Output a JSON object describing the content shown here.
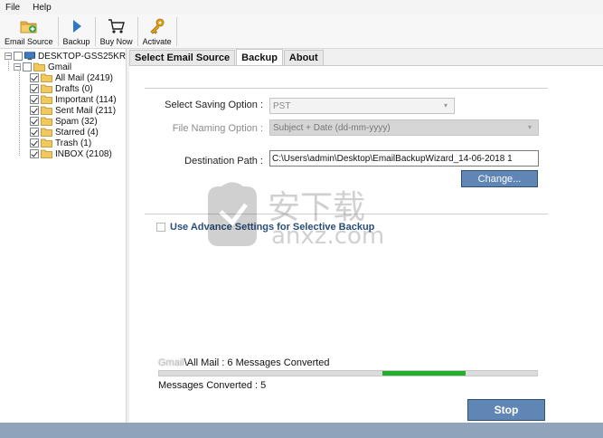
{
  "menu": {
    "items": [
      "File",
      "Help"
    ]
  },
  "toolbar": {
    "email_source": "Email Source",
    "backup": "Backup",
    "buy_now": "Buy Now",
    "activate": "Activate"
  },
  "tree": {
    "root": "DESKTOP-GSS25KR",
    "account": "Gmail",
    "folders": [
      {
        "label": "All Mail (2419)"
      },
      {
        "label": "Drafts (0)"
      },
      {
        "label": "Important (114)"
      },
      {
        "label": "Sent Mail (211)"
      },
      {
        "label": "Spam (32)"
      },
      {
        "label": "Starred (4)"
      },
      {
        "label": "Trash (1)"
      },
      {
        "label": "INBOX (2108)"
      }
    ]
  },
  "tabs": [
    {
      "label": "Select Email Source",
      "active": false
    },
    {
      "label": "Backup",
      "active": true
    },
    {
      "label": "About",
      "active": false
    }
  ],
  "backup": {
    "saving_option_label": "Select Saving Option :",
    "saving_option_value": "PST",
    "naming_option_label": "File Naming Option :",
    "naming_option_value": "Subject + Date (dd-mm-yyyy)",
    "destination_label": "Destination Path :",
    "destination_value": "C:\\Users\\admin\\Desktop\\EmailBackupWizard_14-06-2018 1",
    "change_button": "Change...",
    "advance_settings_label": "Use Advance Settings for Selective Backup",
    "status_prefix": "Gmail",
    "status_text": "\\All Mail : 6 Messages Converted",
    "messages_converted": "Messages Converted : 5",
    "progress": {
      "start": 0.59,
      "end": 0.81
    },
    "stop_button": "Stop"
  },
  "watermark": {
    "text": "安下载",
    "subtext": "anxz.com"
  },
  "colors": {
    "accent_button": "#5f86b4",
    "progress_fill": "#20b02a",
    "advance_text": "#2a4f7a",
    "statusbar": "#8fa3ba"
  }
}
